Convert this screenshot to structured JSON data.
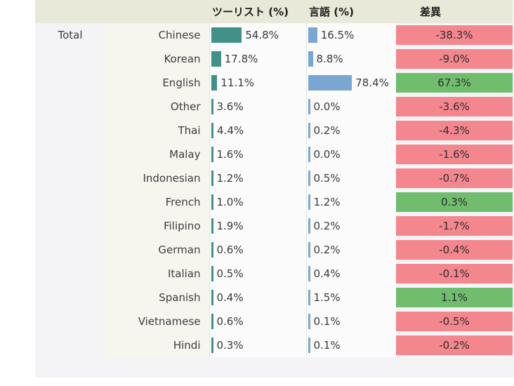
{
  "table": {
    "headers": {
      "blank1": "",
      "blank2": "",
      "tourist": "ツーリスト (%)",
      "language": "言語 (%)",
      "difference": "差異"
    },
    "group_label": "Total",
    "colors": {
      "tourist_bar": "#429189",
      "language_bar": "#7aa7d2",
      "negative": "#f4868e",
      "positive": "#6fbd6d",
      "header_bg": "#e9e9d9",
      "panel_bg": "#f4f4f6"
    },
    "rows": [
      {
        "group": "Total",
        "language": "Chinese",
        "tourist": "54.8%",
        "tourist_val": 54.8,
        "lang": "16.5%",
        "lang_val": 16.5,
        "diff": "-38.3%",
        "sign": "neg"
      },
      {
        "group": "",
        "language": "Korean",
        "tourist": "17.8%",
        "tourist_val": 17.8,
        "lang": "8.8%",
        "lang_val": 8.8,
        "diff": "-9.0%",
        "sign": "neg"
      },
      {
        "group": "",
        "language": "English",
        "tourist": "11.1%",
        "tourist_val": 11.1,
        "lang": "78.4%",
        "lang_val": 78.4,
        "diff": "67.3%",
        "sign": "pos"
      },
      {
        "group": "",
        "language": "Other",
        "tourist": "3.6%",
        "tourist_val": 3.6,
        "lang": "0.0%",
        "lang_val": 0.0,
        "diff": "-3.6%",
        "sign": "neg"
      },
      {
        "group": "",
        "language": "Thai",
        "tourist": "4.4%",
        "tourist_val": 4.4,
        "lang": "0.2%",
        "lang_val": 0.2,
        "diff": "-4.3%",
        "sign": "neg"
      },
      {
        "group": "",
        "language": "Malay",
        "tourist": "1.6%",
        "tourist_val": 1.6,
        "lang": "0.0%",
        "lang_val": 0.0,
        "diff": "-1.6%",
        "sign": "neg"
      },
      {
        "group": "",
        "language": "Indonesian",
        "tourist": "1.2%",
        "tourist_val": 1.2,
        "lang": "0.5%",
        "lang_val": 0.5,
        "diff": "-0.7%",
        "sign": "neg"
      },
      {
        "group": "",
        "language": "French",
        "tourist": "1.0%",
        "tourist_val": 1.0,
        "lang": "1.2%",
        "lang_val": 1.2,
        "diff": "0.3%",
        "sign": "pos"
      },
      {
        "group": "",
        "language": "Filipino",
        "tourist": "1.9%",
        "tourist_val": 1.9,
        "lang": "0.2%",
        "lang_val": 0.2,
        "diff": "-1.7%",
        "sign": "neg"
      },
      {
        "group": "",
        "language": "German",
        "tourist": "0.6%",
        "tourist_val": 0.6,
        "lang": "0.2%",
        "lang_val": 0.2,
        "diff": "-0.4%",
        "sign": "neg"
      },
      {
        "group": "",
        "language": "Italian",
        "tourist": "0.5%",
        "tourist_val": 0.5,
        "lang": "0.4%",
        "lang_val": 0.4,
        "diff": "-0.1%",
        "sign": "neg"
      },
      {
        "group": "",
        "language": "Spanish",
        "tourist": "0.4%",
        "tourist_val": 0.4,
        "lang": "1.5%",
        "lang_val": 1.5,
        "diff": "1.1%",
        "sign": "pos"
      },
      {
        "group": "",
        "language": "Vietnamese",
        "tourist": "0.6%",
        "tourist_val": 0.6,
        "lang": "0.1%",
        "lang_val": 0.1,
        "diff": "-0.5%",
        "sign": "neg"
      },
      {
        "group": "",
        "language": "Hindi",
        "tourist": "0.3%",
        "tourist_val": 0.3,
        "lang": "0.1%",
        "lang_val": 0.1,
        "diff": "-0.2%",
        "sign": "neg"
      }
    ]
  },
  "chart_data": {
    "type": "bar",
    "title": "",
    "categories": [
      "Chinese",
      "Korean",
      "English",
      "Other",
      "Thai",
      "Malay",
      "Indonesian",
      "French",
      "Filipino",
      "German",
      "Italian",
      "Spanish",
      "Vietnamese",
      "Hindi"
    ],
    "series": [
      {
        "name": "ツーリスト (%)",
        "values": [
          54.8,
          17.8,
          11.1,
          3.6,
          4.4,
          1.6,
          1.2,
          1.0,
          1.9,
          0.6,
          0.5,
          0.4,
          0.6,
          0.3
        ],
        "color": "#429189"
      },
      {
        "name": "言語 (%)",
        "values": [
          16.5,
          8.8,
          78.4,
          0.0,
          0.2,
          0.0,
          0.5,
          1.2,
          0.2,
          0.2,
          0.4,
          1.5,
          0.1,
          0.1
        ],
        "color": "#7aa7d2"
      },
      {
        "name": "差異",
        "values": [
          -38.3,
          -9.0,
          67.3,
          -3.6,
          -4.3,
          -1.6,
          -0.7,
          0.3,
          -1.7,
          -0.4,
          -0.1,
          1.1,
          -0.5,
          -0.2
        ]
      }
    ],
    "xlabel": "",
    "ylabel": "",
    "ylim": [
      0,
      100
    ],
    "grid": false,
    "legend": "none"
  }
}
